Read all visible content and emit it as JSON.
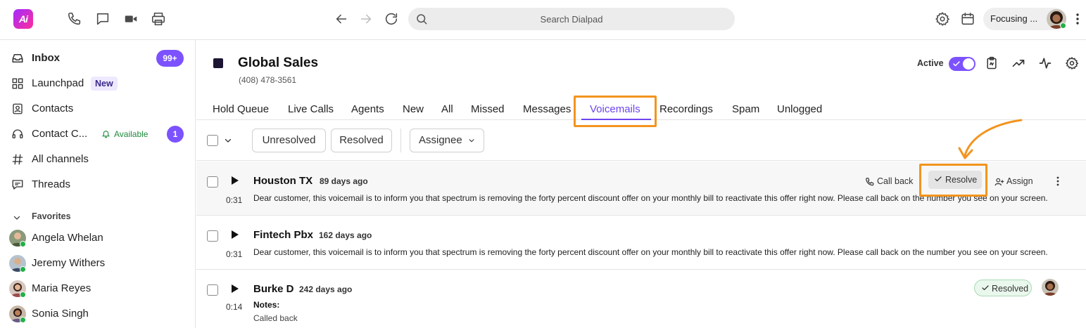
{
  "app": {
    "logo_text": "Ai"
  },
  "search": {
    "placeholder": "Search Dialpad"
  },
  "status": {
    "label": "Focusing ..."
  },
  "sidebar": {
    "items": [
      {
        "label": "Inbox",
        "badge": "99+"
      },
      {
        "label": "Launchpad",
        "tag": "New"
      },
      {
        "label": "Contacts"
      },
      {
        "label": "Contact C...",
        "status": "Available",
        "badge": "1"
      },
      {
        "label": "All channels"
      },
      {
        "label": "Threads"
      }
    ],
    "favorites_heading": "Favorites",
    "favorites": [
      {
        "name": "Angela Whelan"
      },
      {
        "name": "Jeremy Withers"
      },
      {
        "name": "Maria Reyes"
      },
      {
        "name": "Sonia Singh"
      }
    ]
  },
  "header": {
    "title": "Global Sales",
    "phone": "(408) 478-3561",
    "active_label": "Active",
    "toggle_on": true
  },
  "tabs": [
    "Hold Queue",
    "Live Calls",
    "Agents",
    "New",
    "All",
    "Missed",
    "Messages",
    "Voicemails",
    "Recordings",
    "Spam",
    "Unlogged"
  ],
  "active_tab": "Voicemails",
  "filters": {
    "unresolved": "Unresolved",
    "resolved": "Resolved",
    "assignee": "Assignee"
  },
  "voicemails": [
    {
      "name": "Houston TX",
      "age": "89 days ago",
      "duration": "0:31",
      "message": "Dear customer, this voicemail is to inform you that spectrum is removing the forty percent discount offer on your monthly bill to reactivate this offer right now. Please call back on the number you see on your screen.",
      "actions": {
        "call_back": "Call back",
        "resolve": "Resolve",
        "assign": "Assign"
      }
    },
    {
      "name": "Fintech Pbx",
      "age": "162 days ago",
      "duration": "0:31",
      "message": "Dear customer, this voicemail is to inform you that spectrum is removing the forty percent discount offer on your monthly bill to reactivate this offer right now. Please call back on the number you see on your screen."
    },
    {
      "name": "Burke D",
      "age": "242 days ago",
      "duration": "0:14",
      "notes_label": "Notes:",
      "notes": "Called back",
      "status": "Resolved"
    }
  ],
  "colors": {
    "accent": "#6e44f0",
    "badge": "#7c52ff",
    "highlight": "#f3941e",
    "available": "#1e8a3c"
  }
}
